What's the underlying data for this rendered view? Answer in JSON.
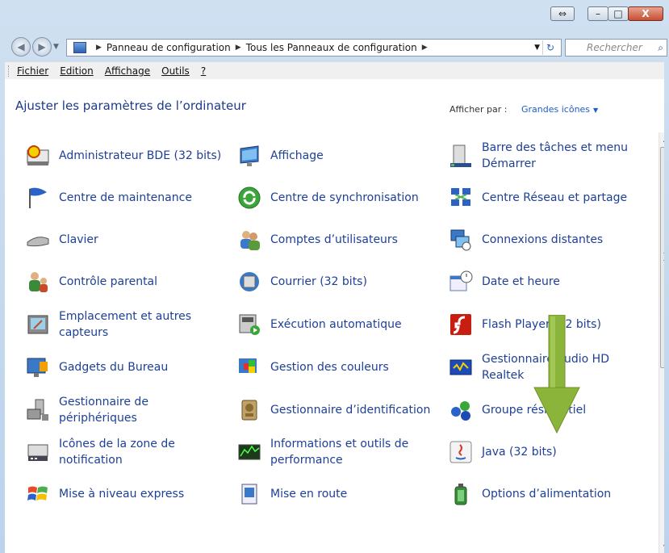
{
  "window": {
    "breadcrumb": [
      "Panneau de configuration",
      "Tous les Panneaux de configuration"
    ],
    "search_placeholder": "Rechercher"
  },
  "menu": [
    "Fichier",
    "Edition",
    "Affichage",
    "Outils",
    "?"
  ],
  "header": {
    "title": "Ajuster les paramètres de l’ordinateur",
    "view_by_label": "Afficher par :",
    "view_by_value": "Grandes icônes"
  },
  "items": [
    {
      "label": "Administrateur BDE (32 bits)",
      "icon": "database-admin-icon"
    },
    {
      "label": "Affichage",
      "icon": "display-icon"
    },
    {
      "label": "Barre des tâches et menu Démarrer",
      "icon": "taskbar-icon"
    },
    {
      "label": "Centre de maintenance",
      "icon": "flag-icon"
    },
    {
      "label": "Centre de synchronisation",
      "icon": "sync-icon"
    },
    {
      "label": "Centre Réseau et partage",
      "icon": "network-icon"
    },
    {
      "label": "Clavier",
      "icon": "keyboard-icon"
    },
    {
      "label": "Comptes d’utilisateurs",
      "icon": "users-icon"
    },
    {
      "label": "Connexions distantes",
      "icon": "remote-icon"
    },
    {
      "label": "Contrôle parental",
      "icon": "parental-icon"
    },
    {
      "label": "Courrier (32 bits)",
      "icon": "mail-icon"
    },
    {
      "label": "Date et heure",
      "icon": "clock-calendar-icon"
    },
    {
      "label": "Emplacement et autres capteurs",
      "icon": "sensor-icon"
    },
    {
      "label": "Exécution automatique",
      "icon": "autoplay-icon"
    },
    {
      "label": "Flash Player (32 bits)",
      "icon": "flash-icon"
    },
    {
      "label": "Gadgets du Bureau",
      "icon": "gadgets-icon"
    },
    {
      "label": "Gestion des couleurs",
      "icon": "color-icon"
    },
    {
      "label": "Gestionnaire audio HD Realtek",
      "icon": "audio-icon"
    },
    {
      "label": "Gestionnaire de périphériques",
      "icon": "device-manager-icon"
    },
    {
      "label": "Gestionnaire d’identification",
      "icon": "credential-icon"
    },
    {
      "label": "Groupe résidentiel",
      "icon": "homegroup-icon"
    },
    {
      "label": "Icônes de la zone de notification",
      "icon": "tray-icon"
    },
    {
      "label": "Informations et outils de performance",
      "icon": "performance-icon"
    },
    {
      "label": "Java (32 bits)",
      "icon": "java-icon"
    },
    {
      "label": "Mise à niveau express",
      "icon": "windows-icon"
    },
    {
      "label": "Mise en route",
      "icon": "getting-started-icon"
    },
    {
      "label": "Options d’alimentation",
      "icon": "power-icon"
    }
  ],
  "colors": {
    "link": "#1d3f96",
    "title": "#1e3b8a",
    "accent_arrow": "#8bb43a"
  }
}
